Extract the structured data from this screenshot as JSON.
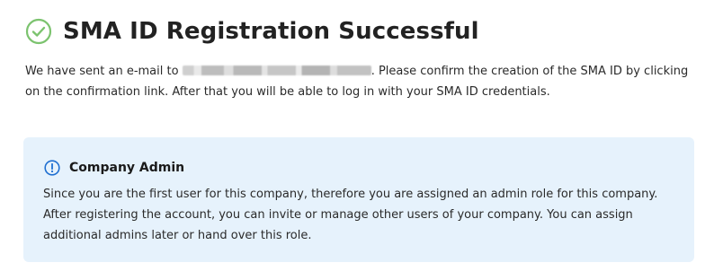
{
  "header": {
    "title": "SMA ID Registration Successful",
    "icon": "check-circle-icon",
    "icon_color": "#7cc36f"
  },
  "message": {
    "prefix": "We have sent an e-mail to ",
    "suffix": ". Please confirm the creation of the SMA ID by clicking on the confirmation link. After that you will be able to log in with your SMA ID credentials."
  },
  "info_card": {
    "icon": "info-circle-icon",
    "icon_color": "#1f6fd1",
    "background": "#e6f2fc",
    "title": "Company Admin",
    "text": "Since you are the first user for this company, therefore you are assigned an admin role for this company. After registering the account, you can invite or manage other users of your company. You can assign additional admins later or hand over this role."
  }
}
